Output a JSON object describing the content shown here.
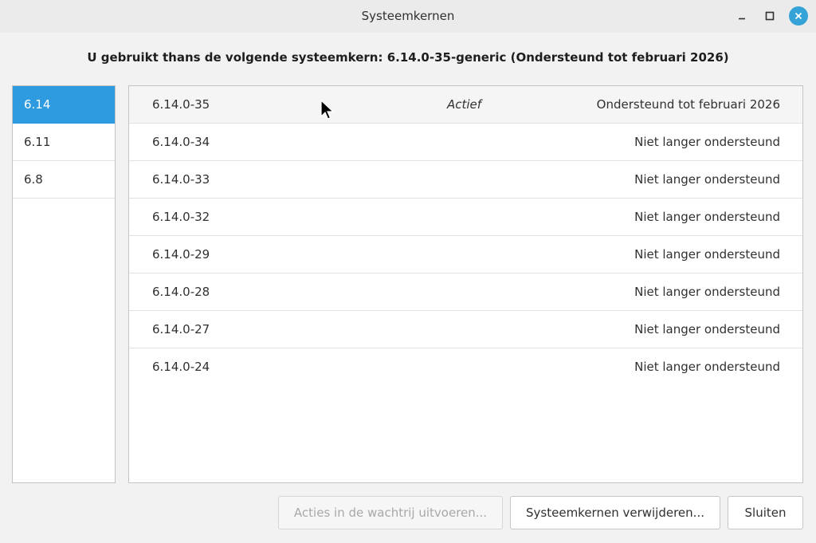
{
  "window": {
    "title": "Systeemkernen",
    "accent_color": "#2e9ae0",
    "close_button_color": "#35a3d8"
  },
  "headline": "U gebruikt thans de volgende systeemkern: 6.14.0-35-generic (Ondersteund tot februari 2026)",
  "sidebar": {
    "selected": "6.14",
    "items": [
      {
        "label": "6.14"
      },
      {
        "label": "6.11"
      },
      {
        "label": "6.8"
      }
    ]
  },
  "kernels": [
    {
      "version": "6.14.0-35",
      "state": "Actief",
      "support": "Ondersteund tot februari 2026"
    },
    {
      "version": "6.14.0-34",
      "state": "",
      "support": "Niet langer ondersteund"
    },
    {
      "version": "6.14.0-33",
      "state": "",
      "support": "Niet langer ondersteund"
    },
    {
      "version": "6.14.0-32",
      "state": "",
      "support": "Niet langer ondersteund"
    },
    {
      "version": "6.14.0-29",
      "state": "",
      "support": "Niet langer ondersteund"
    },
    {
      "version": "6.14.0-28",
      "state": "",
      "support": "Niet langer ondersteund"
    },
    {
      "version": "6.14.0-27",
      "state": "",
      "support": "Niet langer ondersteund"
    },
    {
      "version": "6.14.0-24",
      "state": "",
      "support": "Niet langer ondersteund"
    }
  ],
  "buttons": {
    "queue_label": "Acties in de wachtrij uitvoeren...",
    "remove_label": "Systeemkernen verwijderen...",
    "close_label": "Sluiten"
  },
  "icons": {
    "minimize": "minimize-icon",
    "maximize": "maximize-icon",
    "close": "close-icon",
    "cursor": "mouse-pointer-icon"
  }
}
